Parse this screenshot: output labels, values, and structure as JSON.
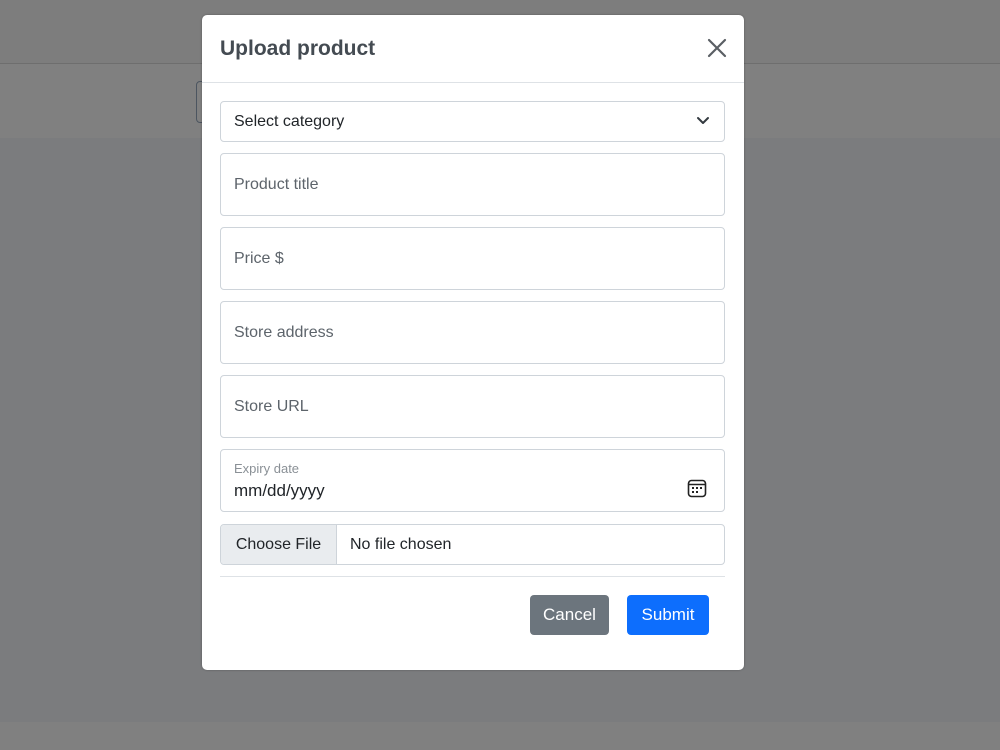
{
  "modal": {
    "title": "Upload product",
    "close_icon": "close-icon",
    "category_select": {
      "selected": "Select category",
      "icon": "chevron-down-icon"
    },
    "fields": {
      "product_title": "Product title",
      "price": "Price $",
      "store_address": "Store address",
      "store_url": "Store URL"
    },
    "expiry": {
      "label": "Expiry date",
      "value": "mm/dd/yyyy",
      "icon": "calendar-icon"
    },
    "file": {
      "button": "Choose File",
      "status": "No file chosen"
    },
    "buttons": {
      "cancel": "Cancel",
      "submit": "Submit"
    },
    "colors": {
      "primary": "#0d6efd",
      "secondary": "#6c757d"
    }
  }
}
